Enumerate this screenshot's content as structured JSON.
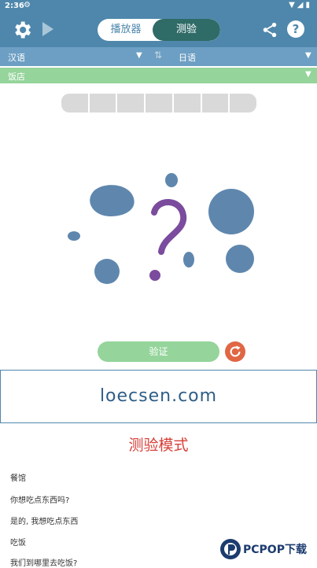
{
  "status": {
    "time": "2:36"
  },
  "toolbar": {
    "player_tab": "播放器",
    "quiz_tab": "测验"
  },
  "language": {
    "source": "汉语",
    "target": "日语"
  },
  "category": {
    "name": "饭店"
  },
  "answer": {
    "slot_count": 7
  },
  "actions": {
    "verify_label": "验证"
  },
  "banner": {
    "site": "loecsen.com"
  },
  "mode_title": "测验模式",
  "phrases": [
    "餐馆",
    "你想吃点东西吗?",
    "是的, 我想吃点东西",
    "吃饭",
    "我们到哪里去吃饭?"
  ],
  "watermark": {
    "text": "PCPOP下载"
  },
  "colors": {
    "header": "#4f87ac",
    "lang_bar": "#6c9fc3",
    "category_bar": "#95d49b",
    "toggle_active": "#2f6b67",
    "mode_title": "#d6403a",
    "blob": "#5f87ae",
    "question_mark": "#7b4b9e",
    "reset": "#e06644"
  }
}
